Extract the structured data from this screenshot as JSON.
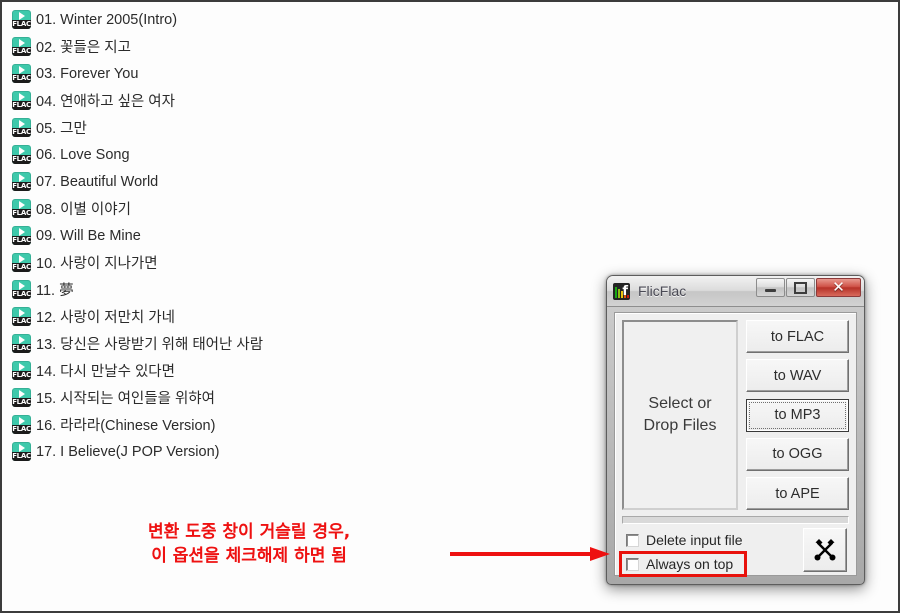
{
  "filelist": {
    "icon_label": "FLAC",
    "items": [
      "01. Winter 2005(Intro)",
      "02. 꽃들은 지고",
      "03. Forever You",
      "04. 연애하고 싶은 여자",
      "05. 그만",
      "06. Love Song",
      "07. Beautiful World",
      "08. 이별 이야기",
      "09. Will Be Mine",
      "10. 사랑이 지나가면",
      "11. 夢",
      "12. 사랑이 저만치 가네",
      "13. 당신은 사랑받기 위해 태어난 사람",
      "14. 다시 만날수 있다면",
      "15. 시작되는 여인들을 위햐여",
      "16. 라라라(Chinese Version)",
      "17. I Believe(J POP Version)"
    ]
  },
  "flicflac": {
    "title": "FlicFlac",
    "window_buttons": {
      "minimize": "minimize-button",
      "maximize": "maximize-button",
      "close": "✕"
    },
    "dropzone": {
      "line1": "Select or",
      "line2": "Drop Files"
    },
    "convert_buttons": [
      {
        "label": "to FLAC",
        "focused": false
      },
      {
        "label": "to WAV",
        "focused": false
      },
      {
        "label": "to MP3",
        "focused": true
      },
      {
        "label": "to OGG",
        "focused": false
      },
      {
        "label": "to APE",
        "focused": false
      }
    ],
    "options": [
      {
        "label": "Delete input file",
        "checked": false,
        "highlighted": false
      },
      {
        "label": "Always on top",
        "checked": false,
        "highlighted": true
      }
    ],
    "tools_button": "tools-button"
  },
  "annotation": {
    "line1": "변환 도중 창이 거슬릴 경우,",
    "line2": "이 옵션을 체크해제 하면 됨",
    "color": "#ee1111"
  },
  "colors": {
    "highlight_red": "#e8120c",
    "annotation_red": "#ee1111",
    "flac_icon_teal": "#3ec9ab",
    "window_frame": "#b9b9b9"
  }
}
